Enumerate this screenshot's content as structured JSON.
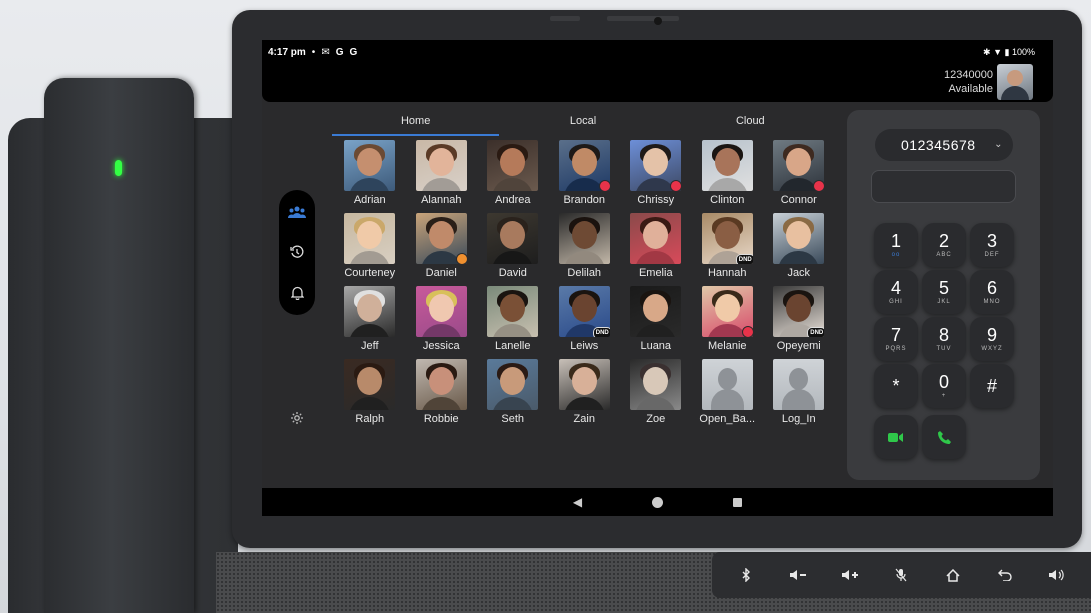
{
  "status": {
    "time": "4:17 pm",
    "icons": [
      "mail-icon",
      "google-icon",
      "google-icon"
    ],
    "battery": "100%"
  },
  "account": {
    "number": "12340000",
    "presence": "Available"
  },
  "tabs": [
    {
      "label": "Home",
      "active": true
    },
    {
      "label": "Local",
      "active": false
    },
    {
      "label": "Cloud",
      "active": false
    }
  ],
  "contacts": [
    {
      "name": "Adrian",
      "badge": ""
    },
    {
      "name": "Alannah",
      "badge": ""
    },
    {
      "name": "Andrea",
      "badge": ""
    },
    {
      "name": "Brandon",
      "badge": "red"
    },
    {
      "name": "Chrissy",
      "badge": "red"
    },
    {
      "name": "Clinton",
      "badge": ""
    },
    {
      "name": "Connor",
      "badge": "red"
    },
    {
      "name": "Courteney",
      "badge": ""
    },
    {
      "name": "Daniel",
      "badge": "orange"
    },
    {
      "name": "David",
      "badge": ""
    },
    {
      "name": "Delilah",
      "badge": ""
    },
    {
      "name": "Emelia",
      "badge": ""
    },
    {
      "name": "Hannah",
      "badge": "DND"
    },
    {
      "name": "Jack",
      "badge": ""
    },
    {
      "name": "Jeff",
      "badge": ""
    },
    {
      "name": "Jessica",
      "badge": ""
    },
    {
      "name": "Lanelle",
      "badge": ""
    },
    {
      "name": "Leiws",
      "badge": "DND"
    },
    {
      "name": "Luana",
      "badge": ""
    },
    {
      "name": "Melanie",
      "badge": "red"
    },
    {
      "name": "Opeyemi",
      "badge": "DND"
    },
    {
      "name": "Ralph",
      "badge": ""
    },
    {
      "name": "Robbie",
      "badge": ""
    },
    {
      "name": "Seth",
      "badge": ""
    },
    {
      "name": "Zain",
      "badge": ""
    },
    {
      "name": "Zoe",
      "badge": ""
    },
    {
      "name": "Open_Ba...",
      "badge": "",
      "placeholder": true
    },
    {
      "name": "Log_In",
      "badge": "",
      "placeholder": true
    }
  ],
  "dialpad": {
    "number": "012345678",
    "keys": [
      {
        "digit": "1",
        "letters": "oo"
      },
      {
        "digit": "2",
        "letters": "ABC"
      },
      {
        "digit": "3",
        "letters": "DEF"
      },
      {
        "digit": "4",
        "letters": "GHI"
      },
      {
        "digit": "5",
        "letters": "JKL"
      },
      {
        "digit": "6",
        "letters": "MNO"
      },
      {
        "digit": "7",
        "letters": "PQRS"
      },
      {
        "digit": "8",
        "letters": "TUV"
      },
      {
        "digit": "9",
        "letters": "WXYZ"
      },
      {
        "digit": "*",
        "letters": ""
      },
      {
        "digit": "0",
        "letters": "+"
      },
      {
        "digit": "#",
        "letters": ""
      }
    ]
  },
  "colors": {
    "accent": "#3a7bd5",
    "call_green": "#2fc84a",
    "busy_red": "#e8334a",
    "away_orange": "#f0902f",
    "led_green": "#33ff44"
  },
  "hardware_buttons": [
    "bluetooth-icon",
    "volume-down-icon",
    "volume-up-icon",
    "mute-icon",
    "home-icon",
    "back-icon",
    "speaker-icon"
  ]
}
